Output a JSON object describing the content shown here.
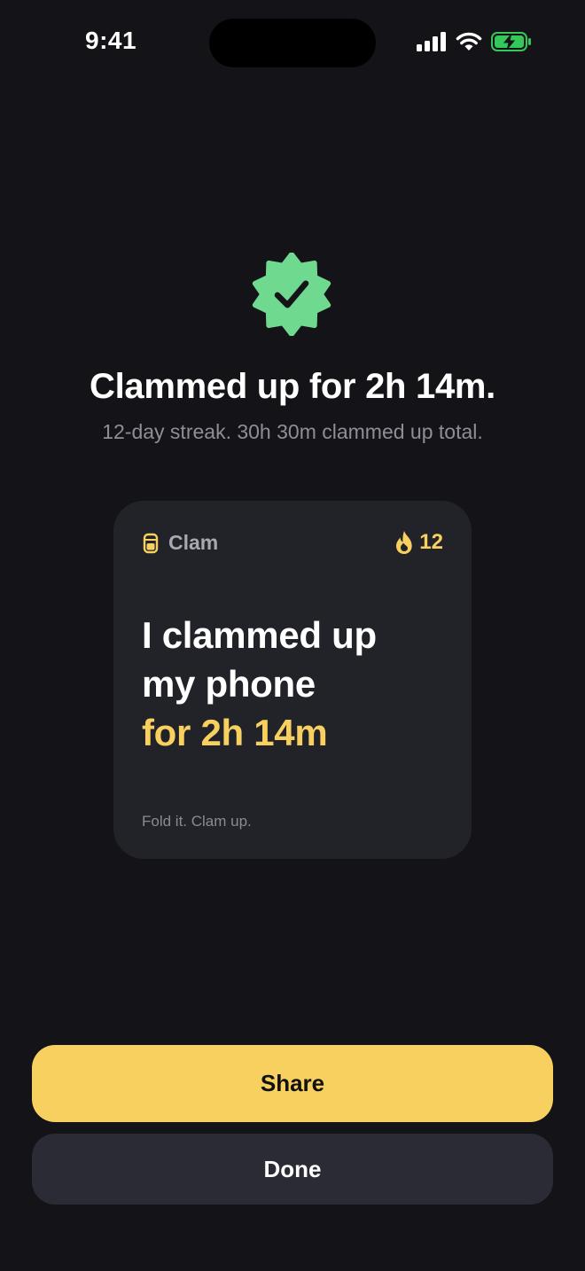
{
  "status_bar": {
    "time": "9:41",
    "icons": [
      "cellular-signal-icon",
      "wifi-icon",
      "battery-charging-icon"
    ],
    "battery_color": "#34c759"
  },
  "result": {
    "icon": "verified-check-badge-icon",
    "icon_color": "#6fd98f",
    "headline": "Clammed up for 2h 14m.",
    "subline": "12-day streak. 30h 30m clammed up total."
  },
  "share_card": {
    "brand_icon": "clam-phone-icon",
    "brand_name": "Clam",
    "streak_icon": "flame-icon",
    "streak_count": "12",
    "message_lines": [
      "I clammed up",
      "my phone"
    ],
    "message_highlight": "for 2h 14m",
    "tagline": "Fold it. Clam up.",
    "accent_color": "#f7d060"
  },
  "actions": {
    "share_label": "Share",
    "done_label": "Done"
  }
}
